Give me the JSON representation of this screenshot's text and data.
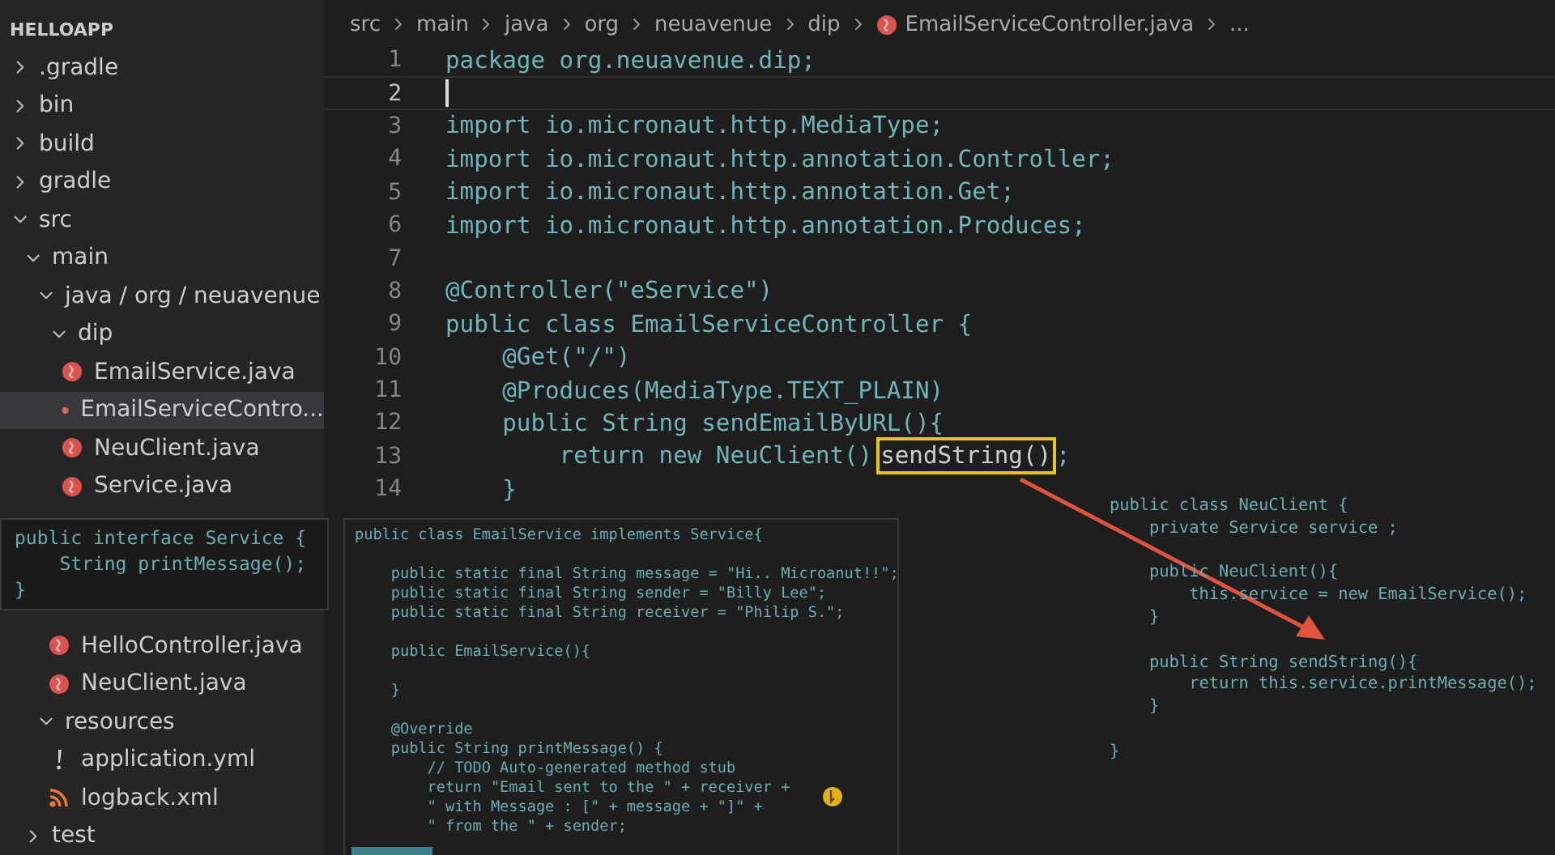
{
  "explorer": {
    "title": "HELLOAPP",
    "tree": [
      {
        "label": ".gradle",
        "kind": "folder",
        "expanded": false,
        "selected": false
      },
      {
        "label": "bin",
        "kind": "folder",
        "expanded": false,
        "selected": false
      },
      {
        "label": "build",
        "kind": "folder",
        "expanded": false,
        "selected": false
      },
      {
        "label": "gradle",
        "kind": "folder",
        "expanded": false,
        "selected": false
      },
      {
        "label": "src",
        "kind": "folder",
        "expanded": true,
        "selected": false,
        "children": [
          {
            "label": "main",
            "kind": "folder",
            "expanded": true,
            "selected": false,
            "children": [
              {
                "label": "java / org / neuavenue",
                "kind": "folder",
                "expanded": true,
                "selected": false,
                "children": [
                  {
                    "label": "dip",
                    "kind": "folder",
                    "expanded": true,
                    "selected": false,
                    "snippet_below": true,
                    "children": [
                      {
                        "label": "EmailService.java",
                        "kind": "java",
                        "selected": false
                      },
                      {
                        "label": "EmailServiceContro...",
                        "kind": "java",
                        "selected": true
                      },
                      {
                        "label": "NeuClient.java",
                        "kind": "java",
                        "selected": false
                      },
                      {
                        "label": "Service.java",
                        "kind": "java",
                        "selected": false
                      }
                    ]
                  },
                  {
                    "label": "HelloController.java",
                    "kind": "java",
                    "selected": false
                  },
                  {
                    "label": "NeuClient.java",
                    "kind": "java",
                    "selected": false
                  }
                ]
              },
              {
                "label": "resources",
                "kind": "folder",
                "expanded": true,
                "selected": false,
                "children": [
                  {
                    "label": "application.yml",
                    "kind": "yml",
                    "selected": false
                  },
                  {
                    "label": "logback.xml",
                    "kind": "xml",
                    "selected": false
                  }
                ]
              }
            ]
          },
          {
            "label": "test",
            "kind": "folder",
            "expanded": false,
            "selected": false
          }
        ]
      }
    ]
  },
  "service_snippet": [
    "public interface Service {",
    "    String printMessage();",
    "}"
  ],
  "breadcrumb": {
    "parts": [
      "src",
      "main",
      "java",
      "org",
      "neuavenue",
      "dip"
    ],
    "file": "EmailServiceController.java",
    "more": "..."
  },
  "editor": {
    "lines": [
      {
        "number": "1",
        "text": "package org.neuavenue.dip;",
        "current": false
      },
      {
        "number": "2",
        "current": true
      },
      {
        "number": "3",
        "text": "import io.micronaut.http.MediaType;",
        "current": false
      },
      {
        "number": "4",
        "text": "import io.micronaut.http.annotation.Controller;",
        "current": false
      },
      {
        "number": "5",
        "text": "import io.micronaut.http.annotation.Get;",
        "current": false
      },
      {
        "number": "6",
        "text": "import io.micronaut.http.annotation.Produces;",
        "current": false
      },
      {
        "number": "7",
        "current": false
      },
      {
        "number": "8",
        "text": "@Controller(\"eService\")",
        "current": false
      },
      {
        "number": "9",
        "text": "public class EmailServiceController {",
        "current": false
      },
      {
        "number": "10",
        "text": "    @Get(\"/\")",
        "current": false
      },
      {
        "number": "11",
        "text": "    @Produces(MediaType.TEXT_PLAIN)",
        "current": false
      },
      {
        "number": "12",
        "text": "    public String sendEmailByURL(){",
        "current": false
      },
      {
        "number": "13",
        "text": "        return new NeuClient()",
        "boxed": "sendString()",
        "after": ";",
        "current": false
      },
      {
        "number": "14",
        "text": "    }",
        "current": false
      }
    ]
  },
  "email_service_popup": [
    [
      "public class EmailService implements Service{"
    ],
    [
      "    public static final String message = \"Hi.. Microanut!!\";",
      "    public static final String sender = \"Billy Lee\";",
      "    public static final String receiver = \"Philip S.\";"
    ],
    [
      "    public EmailService(){"
    ],
    [
      "    }"
    ],
    [
      "    @Override",
      "    public String printMessage() {",
      "        // TODO Auto-generated method stub",
      "        return \"Email sent to the \" + receiver +",
      "        \" with Message : [\" + message + \"]\" +",
      "        \" from the \" + sender;"
    ]
  ],
  "neuclient_snippet": [
    [
      "public class NeuClient {",
      "    private Service service ;"
    ],
    [
      "    public NeuClient(){",
      "        this.service = new EmailService();",
      "    }"
    ],
    [
      "    public String sendString(){",
      "        return this.service.printMessage();",
      "    }"
    ],
    [
      "}"
    ]
  ]
}
